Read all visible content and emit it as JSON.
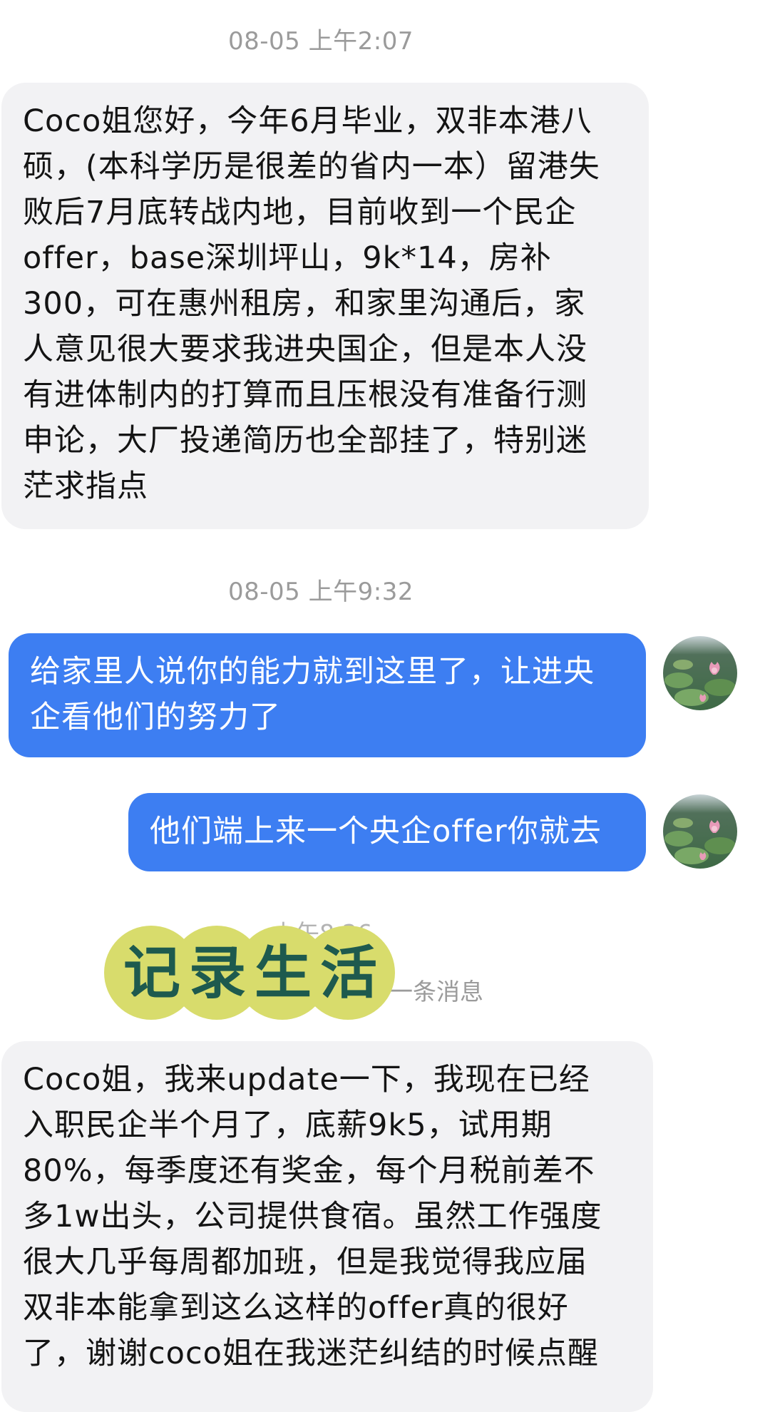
{
  "messages": [
    {
      "type": "time",
      "text": "08-05 上午2:07"
    },
    {
      "type": "incoming",
      "text": "Coco姐您好，今年6月毕业，双非本港八\n硕，(本科学历是很差的省内一本）留港失\n败后7月底转战内地，目前收到一个民企\noffer，base深圳坪山，9k*14，房补\n300，可在惠州租房，和家里沟通后，家\n人意见很大要求我进央国企，但是本人没\n有进体制内的打算而且压根没有准备行测\n申论，大厂投递简历也全部挂了，特别迷\n茫求指点"
    },
    {
      "type": "time",
      "text": "08-05 上午9:32"
    },
    {
      "type": "outgoing",
      "text": "给家里人说你的能力就到这里了，让进央\n企看他们的努力了"
    },
    {
      "type": "outgoing",
      "text": "他们端上来一个央企offer你就去"
    },
    {
      "type": "time",
      "text": "上午8:26"
    },
    {
      "type": "notice",
      "text": "一条消息"
    },
    {
      "type": "incoming",
      "text": "Coco姐，我来update一下，我现在已经\n入职民企半个月了，底薪9k5，试用期\n80%，每季度还有奖金，每个月税前差不\n多1w出头，公司提供食宿。虽然工作强度\n很大几乎每周都加班，但是我觉得我应届\n双非本能拿到这么这样的offer真的很好\n了，谢谢coco姐在我迷茫纠结的时候点醒"
    }
  ],
  "sticker": {
    "chars": [
      "记",
      "录",
      "生",
      "活"
    ],
    "background_color": "#d8dc6c",
    "text_color": "#1e5a4e"
  },
  "avatar": {
    "icon": "lotus-pond-avatar"
  },
  "colors": {
    "incoming_bubble": "#f2f2f4",
    "outgoing_bubble": "#3d7ef2",
    "timestamp": "#9b9b9b"
  }
}
